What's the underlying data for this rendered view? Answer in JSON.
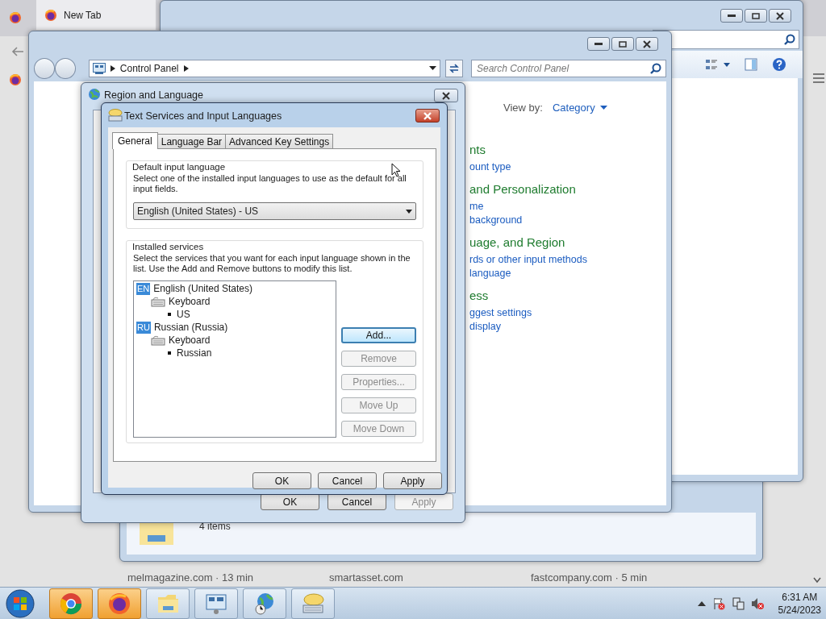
{
  "browser": {
    "tab_title": "New Tab",
    "feed": [
      "melmagazine.com · 13 min",
      "smartasset.com",
      "fastcompany.com · 5 min"
    ]
  },
  "explorer": {
    "status": "4 items"
  },
  "control_panel": {
    "breadcrumb": "Control Panel",
    "search_placeholder": "Search Control Panel",
    "view_by_label": "View by:",
    "view_by_value": "Category",
    "categories": [
      {
        "title": "nts",
        "links": [
          "ount type"
        ]
      },
      {
        "title": "and Personalization",
        "links": [
          "me",
          "background"
        ]
      },
      {
        "title": "uage, and Region",
        "links": [
          "rds or other input methods",
          "language"
        ]
      },
      {
        "title": "ess",
        "links": [
          "ggest settings",
          "display"
        ]
      }
    ]
  },
  "region_dialog": {
    "title": "Region and Language",
    "buttons": [
      {
        "label": "OK",
        "disabled": false
      },
      {
        "label": "Cancel",
        "disabled": false
      },
      {
        "label": "Apply",
        "disabled": true
      }
    ]
  },
  "text_services": {
    "title": "Text Services and Input Languages",
    "tabs": [
      {
        "label": "General",
        "selected": true
      },
      {
        "label": "Language Bar",
        "selected": false
      },
      {
        "label": "Advanced Key Settings",
        "selected": false
      }
    ],
    "default_language": {
      "legend": "Default input language",
      "description": "Select one of the installed input languages to use as the default for all input fields.",
      "value": "English (United States) - US"
    },
    "installed_services": {
      "legend": "Installed services",
      "description": "Select the services that you want for each input language shown in the list. Use the Add and Remove buttons to modify this list.",
      "tree": [
        {
          "kind": "language",
          "badge": "EN",
          "label": "English (United States)",
          "children": [
            {
              "kind": "keyboard",
              "label": "Keyboard",
              "children": [
                {
                  "kind": "layout",
                  "label": "US"
                }
              ]
            }
          ]
        },
        {
          "kind": "language",
          "badge": "RU",
          "label": "Russian (Russia)",
          "children": [
            {
              "kind": "keyboard",
              "label": "Keyboard",
              "children": [
                {
                  "kind": "layout",
                  "label": "Russian"
                }
              ]
            }
          ]
        }
      ],
      "buttons": [
        {
          "label": "Add...",
          "disabled": false,
          "focused": true
        },
        {
          "label": "Remove",
          "disabled": true,
          "focused": false
        },
        {
          "label": "Properties...",
          "disabled": true,
          "focused": false
        },
        {
          "label": "Move Up",
          "disabled": true,
          "focused": false
        },
        {
          "label": "Move Down",
          "disabled": true,
          "focused": false
        }
      ]
    },
    "buttons": [
      {
        "label": "OK",
        "disabled": false
      },
      {
        "label": "Cancel",
        "disabled": false
      },
      {
        "label": "Apply",
        "disabled": false
      }
    ]
  },
  "taskbar": {
    "apps": [
      {
        "kind": "chrome",
        "attention": true
      },
      {
        "kind": "firefox",
        "attention": true
      },
      {
        "kind": "explorer",
        "attention": false
      },
      {
        "kind": "control-panel",
        "attention": false
      },
      {
        "kind": "region",
        "attention": false
      },
      {
        "kind": "keyboard",
        "attention": false
      }
    ],
    "time": "6:31 AM",
    "date": "5/24/2023"
  }
}
